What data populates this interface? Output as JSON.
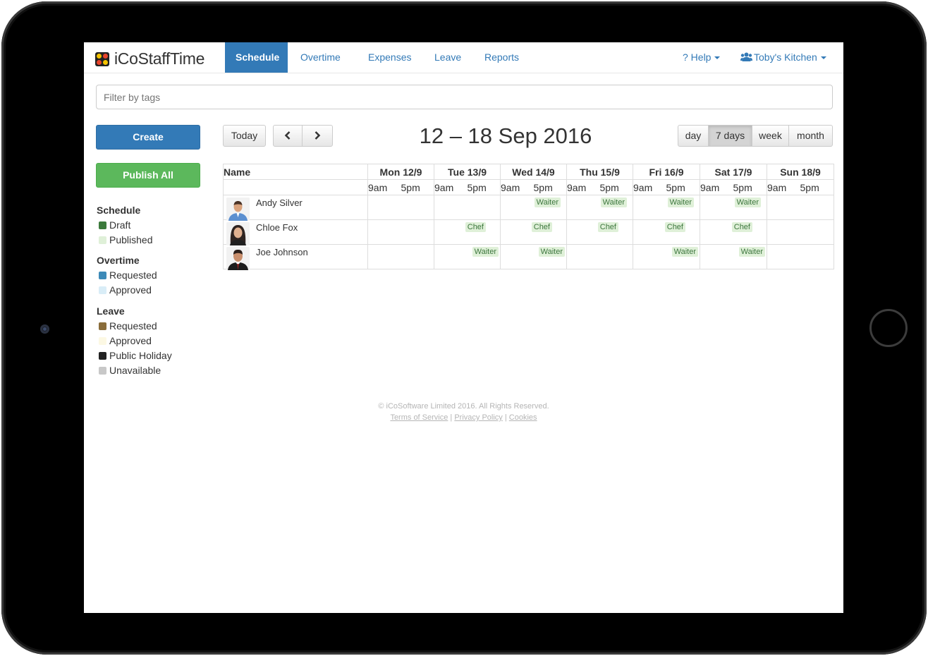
{
  "brand": {
    "name": "iCoStaffTime"
  },
  "nav": {
    "items": [
      {
        "label": "Schedule",
        "active": true
      },
      {
        "label": "Overtime"
      },
      {
        "label": "Expenses"
      },
      {
        "label": "Leave"
      },
      {
        "label": "Reports"
      }
    ],
    "help_label": "? Help",
    "account_label": "Toby's Kitchen",
    "account_icon": "users-icon"
  },
  "filter": {
    "placeholder": "Filter by tags"
  },
  "sidebar": {
    "create_label": "Create",
    "publish_label": "Publish All",
    "groups": [
      {
        "title": "Schedule",
        "items": [
          {
            "label": "Draft",
            "color": "#3c7a3c"
          },
          {
            "label": "Published",
            "color": "#dff0d8"
          }
        ]
      },
      {
        "title": "Overtime",
        "items": [
          {
            "label": "Requested",
            "color": "#3d8ab8"
          },
          {
            "label": "Approved",
            "color": "#d9edf7"
          }
        ]
      },
      {
        "title": "Leave",
        "items": [
          {
            "label": "Requested",
            "color": "#8a6d3b"
          },
          {
            "label": "Approved",
            "color": "#fcf8e3"
          },
          {
            "label": "Public Holiday",
            "color": "#222222"
          },
          {
            "label": "Unavailable",
            "color": "#c8c8c8"
          }
        ]
      }
    ]
  },
  "toolbar": {
    "today_label": "Today",
    "prev_icon": "chevron-left-icon",
    "next_icon": "chevron-right-icon",
    "range_title": "12 – 18 Sep 2016",
    "views": [
      {
        "label": "day"
      },
      {
        "label": "7 days",
        "active": true
      },
      {
        "label": "week"
      },
      {
        "label": "month"
      }
    ]
  },
  "grid": {
    "name_header": "Name",
    "days": [
      "Mon 12/9",
      "Tue 13/9",
      "Wed 14/9",
      "Thu 15/9",
      "Fri 16/9",
      "Sat 17/9",
      "Sun 18/9"
    ],
    "times": [
      "9am",
      "5pm"
    ],
    "employees": [
      {
        "name": "Andy Silver",
        "shifts": [
          "",
          "",
          "Waiter",
          "Waiter",
          "Waiter",
          "Waiter",
          ""
        ]
      },
      {
        "name": "Chloe Fox",
        "shifts": [
          "",
          "Chef",
          "Chef",
          "Chef",
          "Chef",
          "Chef",
          ""
        ]
      },
      {
        "name": "Joe Johnson",
        "shifts": [
          "",
          "Waiter",
          "Waiter",
          "",
          "Waiter",
          "Waiter",
          ""
        ]
      }
    ]
  },
  "footer": {
    "copyright": "© iCoSoftware Limited 2016. All Rights Reserved.",
    "links": [
      "Terms of Service",
      "Privacy Policy",
      "Cookies"
    ]
  }
}
